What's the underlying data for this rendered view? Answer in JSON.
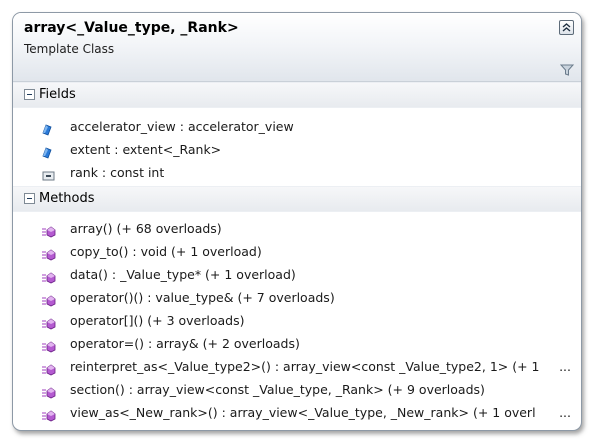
{
  "header": {
    "title": "array<_Value_type, _Rank>",
    "subtitle": "Template Class"
  },
  "fields_section": {
    "label": "Fields",
    "items": [
      {
        "text": "accelerator_view : accelerator_view",
        "icon": "field-icon"
      },
      {
        "text": "extent : extent<_Rank>",
        "icon": "field-icon"
      },
      {
        "text": "rank : const int",
        "icon": "constant-icon"
      }
    ]
  },
  "methods_section": {
    "label": "Methods",
    "items": [
      {
        "text": "array() (+ 68 overloads)",
        "icon": "method-icon"
      },
      {
        "text": "copy_to() : void (+ 1 overload)",
        "icon": "method-icon"
      },
      {
        "text": "data() : _Value_type* (+ 1 overload)",
        "icon": "method-icon"
      },
      {
        "text": "operator()() : value_type& (+ 7 overloads)",
        "icon": "method-icon"
      },
      {
        "text": "operator[]() (+ 3 overloads)",
        "icon": "method-icon"
      },
      {
        "text": "operator=() : array& (+ 2 overloads)",
        "icon": "method-icon"
      },
      {
        "text": "reinterpret_as<_Value_type2>() : array_view<const _Value_type2, 1> (+ 1",
        "icon": "method-icon",
        "ellipsis": "..."
      },
      {
        "text": "section() : array_view<const _Value_type, _Rank> (+ 9 overloads)",
        "icon": "method-icon"
      },
      {
        "text": "view_as<_New_rank>() : array_view<_Value_type, _New_rank> (+ 1 overl",
        "icon": "method-icon",
        "ellipsis": "..."
      }
    ]
  },
  "colors": {
    "border": "#8d99a6",
    "field_icon": "#1d6fcf",
    "method_icon": "#a23fbf"
  }
}
